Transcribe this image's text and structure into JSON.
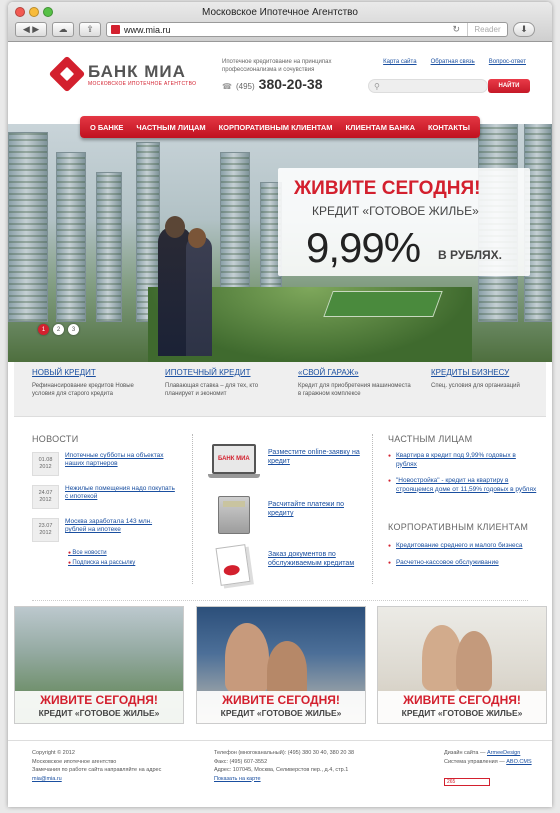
{
  "browser": {
    "window_title": "Московское Ипотечное Агентство",
    "url": "www.mia.ru",
    "reader_label": "Reader"
  },
  "header": {
    "logo_name": "БАНК МИА",
    "logo_sub": "МОСКОВСКОЕ ИПОТЕЧНОЕ АГЕНТСТВО",
    "slogan": "Ипотечное кредитование на принципах профессионализма и сочувствия",
    "phone_code": "(495)",
    "phone_number": "380-20-38",
    "top_links": [
      "Карта сайта",
      "Обратная связь",
      "Вопрос-ответ"
    ],
    "search_button": "НАЙТИ"
  },
  "nav": [
    "О БАНКЕ",
    "ЧАСТНЫМ ЛИЦАМ",
    "КОРПОРАТИВНЫМ КЛИЕНТАМ",
    "КЛИЕНТАМ БАНКА",
    "КОНТАКТЫ"
  ],
  "hero": {
    "headline": "ЖИВИТЕ СЕГОДНЯ!",
    "subline": "КРЕДИТ «ГОТОВОЕ ЖИЛЬЕ»",
    "rate": "9,99%",
    "currency": "В РУБЛЯХ.",
    "slides": [
      "1",
      "2",
      "3"
    ],
    "active_slide": 1
  },
  "features": [
    {
      "title": "НОВЫЙ КРЕДИТ",
      "text": "Рефинансирование кредитов Новые условия для старого кредита"
    },
    {
      "title": "ИПОТЕЧНЫЙ КРЕДИТ",
      "text": "Плавающая ставка – для тех, кто планирует и экономит"
    },
    {
      "title": "«СВОЙ ГАРАЖ»",
      "text": "Кредит для приобретения машиноместа в гаражном комплексе"
    },
    {
      "title": "КРЕДИТЫ БИЗНЕСУ",
      "text": "Спец. условия для организаций"
    }
  ],
  "news": {
    "heading": "НОВОСТИ",
    "items": [
      {
        "date": "01.08 2012",
        "text": "Ипотечные субботы на объектах наших партнеров"
      },
      {
        "date": "24.07 2012",
        "text": "Нежилые помещения надо покупать с ипотекой"
      },
      {
        "date": "23.07 2012",
        "text": "Москва заработала 143 млн. рублей на ипотеке"
      }
    ],
    "links": [
      "Все новости",
      "Подписка на рассылку"
    ]
  },
  "services": {
    "laptop_label": "БАНК МИА",
    "items": [
      "Разместите online-заявку на кредит",
      "Расчитайте платежи по кредиту",
      "Заказ документов по обслуживаемым кредитам"
    ]
  },
  "right": {
    "private_heading": "ЧАСТНЫМ ЛИЦАМ",
    "private_links": [
      "Квартира в кредит под 9,99% годовых в рублях",
      "\"Новостройка\" - кредит на квартиру в строящемся доме от 11,59% годовых в рублях"
    ],
    "corp_heading": "КОРПОРАТИВНЫМ КЛИЕНТАМ",
    "corp_links": [
      "Кредитование среднего и малого бизнеса",
      "Расчетно-кассовое обслуживание"
    ]
  },
  "tiles": [
    {
      "headline": "ЖИВИТЕ СЕГОДНЯ!",
      "subline": "КРЕДИТ «ГОТОВОЕ ЖИЛЬЕ»"
    },
    {
      "headline": "ЖИВИТЕ СЕГОДНЯ!",
      "subline": "КРЕДИТ «ГОТОВОЕ ЖИЛЬЕ»"
    },
    {
      "headline": "ЖИВИТЕ СЕГОДНЯ!",
      "subline": "КРЕДИТ «ГОТОВОЕ ЖИЛЬЕ»"
    }
  ],
  "footer": {
    "copyright": "Copyright © 2012",
    "company": "Московское ипотечное агентство",
    "remarks": "Замечания по работе сайта направляйте на адрес",
    "email": "mia@mia.ru",
    "phone": "Телефон (многоканальный): (495) 380 30 40, 380 20 38",
    "fax": "Факс: (495) 607-3552",
    "address": "Адрес: 107045, Москва, Селиверстов пер., д.4, стр.1",
    "map_link": "Показать на карте",
    "design_label": "Дизайн сайта —",
    "design_link": "ArmeeDesign",
    "cms_label": "Система управления —",
    "cms_link": "ABO.CMS",
    "counter": "265"
  },
  "colors": {
    "brand_red": "#d3202e",
    "link_blue": "#1a4fa0"
  }
}
